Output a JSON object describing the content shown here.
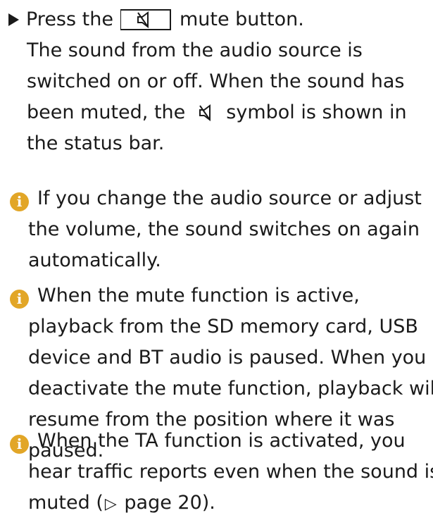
{
  "step": {
    "bullet_icon": "triangle-right-icon",
    "line1_before": "Press the",
    "line1_after": "mute button.",
    "key_icon": "mute-speaker-icon",
    "line2": "The sound from the audio source is",
    "line3": "switched on or off. When the sound has",
    "line4_before": "been muted, the",
    "line4_after": "symbol is shown in",
    "line5": "the status bar."
  },
  "notes": [
    {
      "icon": "info-icon",
      "icon_glyph": "i",
      "lines": [
        "If you change the audio source or adjust",
        "the volume, the sound switches on again",
        "automatically."
      ]
    },
    {
      "icon": "info-icon",
      "icon_glyph": "i",
      "lines": [
        "When the mute function is active,",
        "playback from the SD memory card, USB",
        "device and BT audio is paused. When you",
        "deactivate the mute function, playback will",
        "resume from the position where it was",
        "paused."
      ]
    },
    {
      "icon": "info-icon",
      "icon_glyph": "i",
      "lines": [
        "When the TA function is activated, you",
        "hear traffic reports even when the sound is"
      ],
      "last_before": "muted (",
      "last_ref_symbol": "▷",
      "last_after": " page 20)."
    }
  ],
  "colors": {
    "info_icon": "#e2a627",
    "text": "#1a1a1a"
  }
}
